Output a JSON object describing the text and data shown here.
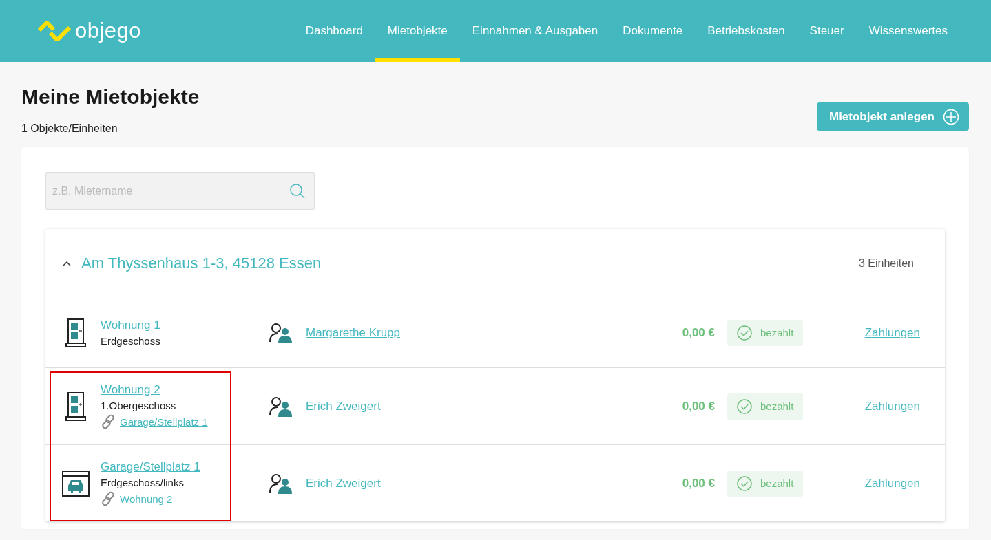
{
  "header": {
    "logo_text": "objego",
    "nav": [
      {
        "label": "Dashboard",
        "selected": false
      },
      {
        "label": "Mietobjekte",
        "selected": true
      },
      {
        "label": "Einnahmen & Ausgaben",
        "selected": false
      },
      {
        "label": "Dokumente",
        "selected": false
      },
      {
        "label": "Betriebskosten",
        "selected": false
      },
      {
        "label": "Steuer",
        "selected": false
      },
      {
        "label": "Wissenswertes",
        "selected": false
      }
    ]
  },
  "page": {
    "title": "Meine Mietobjekte",
    "subtitle": "1 Objekte/Einheiten",
    "create_button": "Mietobjekt anlegen"
  },
  "search": {
    "placeholder": "z.B. Mietername"
  },
  "property": {
    "address": "Am Thyssenhaus 1-3, 45128 Essen",
    "expanded": true,
    "unit_count": "3 Einheiten",
    "units": [
      {
        "kind": "apartment",
        "name": "Wohnung 1",
        "floor": "Erdgeschoss",
        "tenant": "Margarethe Krupp",
        "amount": "0,00 €",
        "status": {
          "kind": "paid",
          "label": "bezahlt"
        },
        "payments_link": "Zahlungen",
        "highlighted": false
      },
      {
        "kind": "apartment",
        "name": "Wohnung 2",
        "floor": "1.Obergeschoss",
        "linked": "Garage/Stellplatz 1",
        "tenant": "Erich Zweigert",
        "amount": "0,00 €",
        "status": {
          "kind": "paid",
          "label": "bezahlt"
        },
        "payments_link": "Zahlungen",
        "highlighted": true
      },
      {
        "kind": "garage",
        "name": "Garage/Stellplatz 1",
        "floor": "Erdgeschoss/links",
        "linked": "Wohnung 2",
        "tenant": "Erich Zweigert",
        "amount": "0,00 €",
        "status": {
          "kind": "paid",
          "label": "bezahlt"
        },
        "payments_link": "Zahlungen",
        "highlighted": true
      }
    ]
  }
}
